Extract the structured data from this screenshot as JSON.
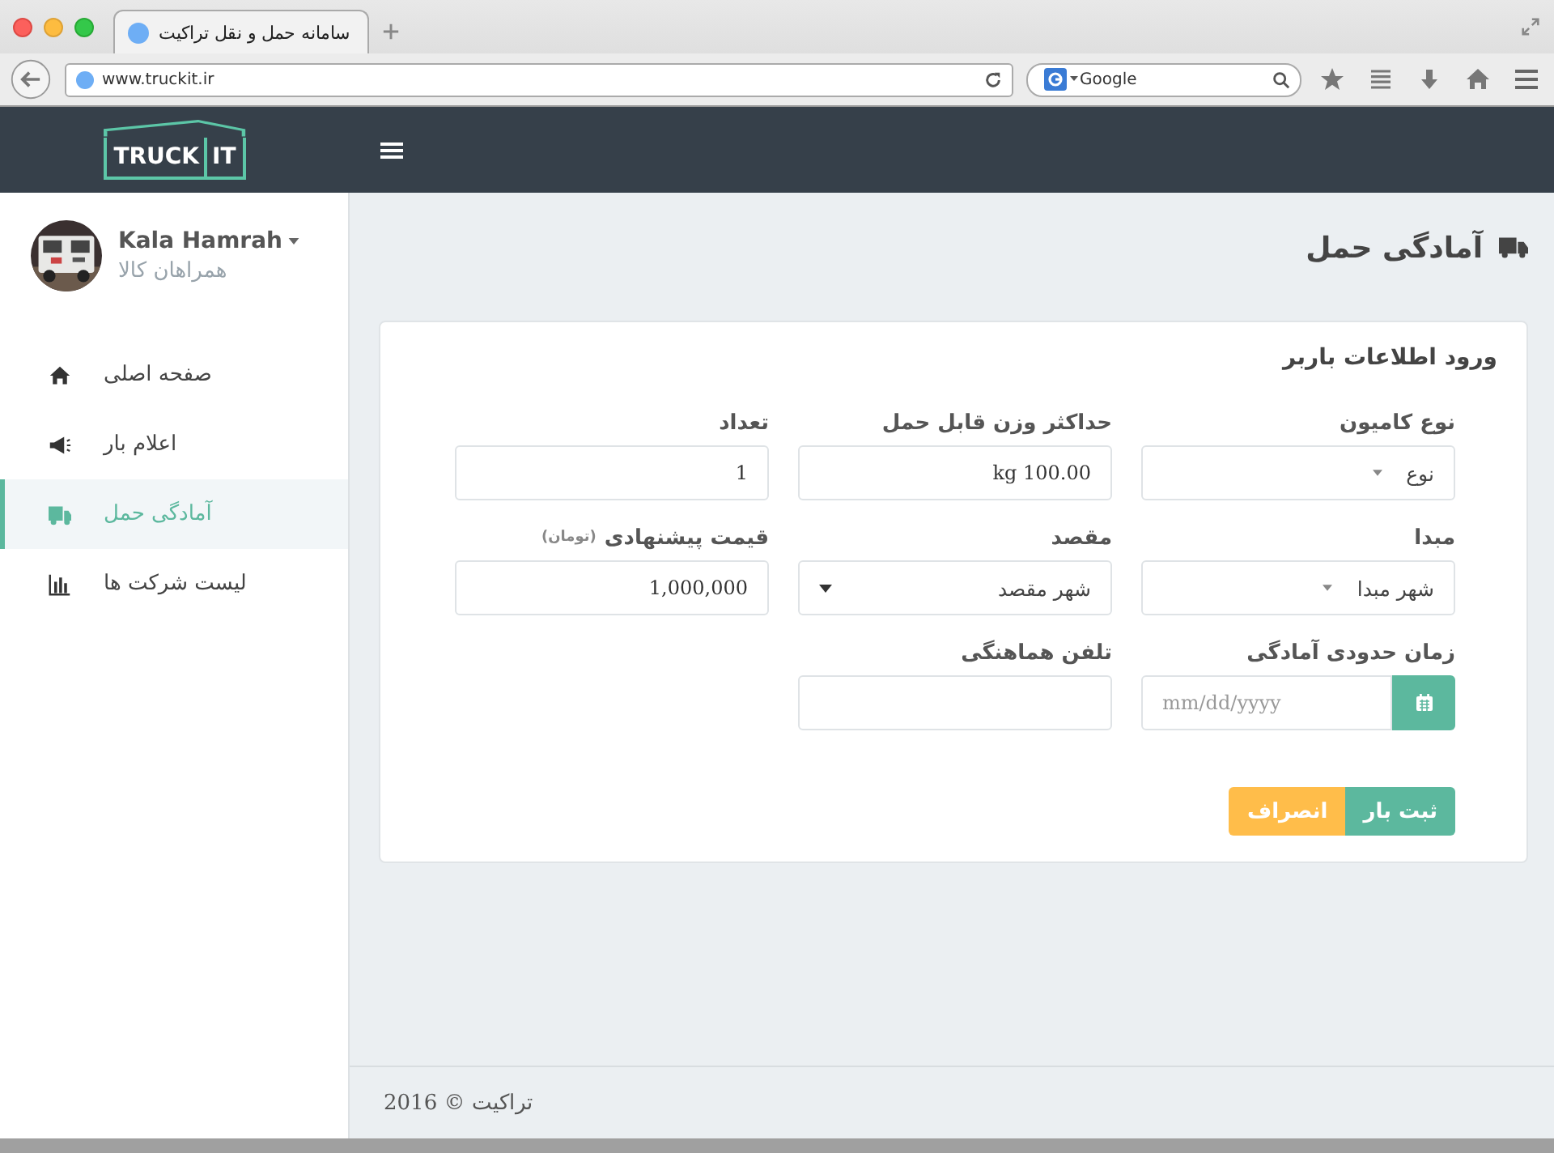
{
  "browser": {
    "tab_title": "سامانه حمل و نقل تراکیت",
    "url": "www.truckit.ir",
    "search_placeholder": "Google"
  },
  "header": {
    "logo_left": "TRUCK",
    "logo_right": "IT"
  },
  "user": {
    "name": "Kala Hamrah",
    "company": "همراهان کالا"
  },
  "sidebar": {
    "items": [
      {
        "label": "صفحه اصلی",
        "selected": false
      },
      {
        "label": "اعلام بار",
        "selected": false
      },
      {
        "label": "آمادگی حمل",
        "selected": true
      },
      {
        "label": "لیست شرکت ها",
        "selected": false
      }
    ]
  },
  "page_title": "آمادگی حمل",
  "form": {
    "title": "ورود اطلاعات باربر",
    "fields": [
      {
        "label": "نوع کامیون",
        "kind": "select",
        "value": "نوع"
      },
      {
        "label": "حداکثر وزن قابل حمل",
        "kind": "text",
        "value": "kg 100.00"
      },
      {
        "label": "تعداد",
        "kind": "text",
        "value": "1"
      },
      {
        "label": "مبدا",
        "kind": "select",
        "value": "شهر مبدا"
      },
      {
        "label": "مقصد",
        "kind": "dropdown",
        "value": "شهر مقصد"
      },
      {
        "label": "قیمت پیشنهادی",
        "note": "(تومان)",
        "kind": "text",
        "value": "1,000,000"
      },
      {
        "label": "زمان حدودی آمادگی",
        "kind": "date",
        "placeholder": "mm/dd/yyyy"
      },
      {
        "label": "تلفن هماهنگی",
        "kind": "text"
      }
    ],
    "buttons": [
      {
        "label": "ثبت بار",
        "kind": "primary"
      },
      {
        "label": "انصراف",
        "kind": "warning"
      }
    ]
  },
  "footer": "تراکیت © 2016"
}
